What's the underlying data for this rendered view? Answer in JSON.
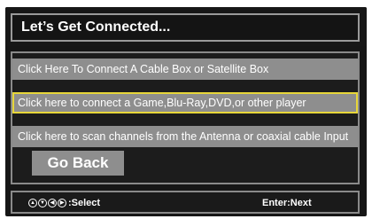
{
  "header": {
    "title": "Let’s Get Connected..."
  },
  "options": [
    {
      "label": "Click Here To Connect A Cable Box or Satellite Box"
    },
    {
      "label": "Click here to connect a Game,Blu-Ray,DVD,or other player"
    },
    {
      "label": "Click here to scan channels from the Antenna or coaxial cable Input"
    }
  ],
  "back_button": {
    "label": "Go Back"
  },
  "footer": {
    "select_label": ":Select",
    "next_label": "Enter:Next",
    "nav_icons": [
      "up-icon",
      "down-icon",
      "left-icon",
      "right-icon"
    ]
  },
  "colors": {
    "highlight": "#e7d63a",
    "option_bg": "#8e8e8e",
    "screen_bg": "#161616"
  }
}
